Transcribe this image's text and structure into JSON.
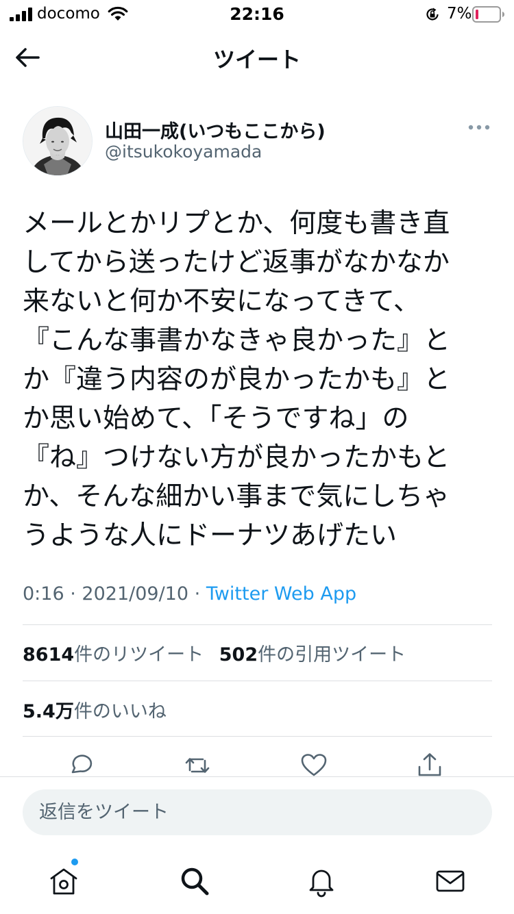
{
  "status_bar": {
    "carrier": "docomo",
    "time": "22:16",
    "battery": "7%",
    "icons": [
      "signal-icon",
      "wifi-icon",
      "orientation-lock-icon",
      "battery-icon"
    ]
  },
  "header": {
    "title": "ツイート",
    "back_icon": "back-arrow-icon"
  },
  "tweet": {
    "author": {
      "name": "山田一成(いつもここから)",
      "handle": "@itsukokoyamada"
    },
    "body_lines": [
      "メールとかリプとか、何度も書き直",
      "してから送ったけど返事がなかなか",
      "来ないと何か不安になってきて、",
      "『こんな事書かなきゃ良かった』と",
      "か『違う内容のが良かったかも』と",
      "か思い始めて、「そうですね」の",
      "『ね』つけない方が良かったかもと",
      "か、そんな細かい事まで気にしちゃ",
      "うような人にドーナツあげたい"
    ],
    "time": "0:16",
    "date": "2021/09/10",
    "separator": "·",
    "source": "Twitter Web App",
    "stats": {
      "retweets_count": "8614",
      "retweets_label": "件のリツイート",
      "quotes_count": "502",
      "quotes_label": "件の引用ツイート",
      "likes_count": "5.4万",
      "likes_label": "件のいいね"
    },
    "actions": [
      "reply-icon",
      "retweet-icon",
      "like-icon",
      "share-icon"
    ]
  },
  "reply_box": {
    "placeholder": "返信をツイート",
    "value": ""
  },
  "bottom_nav": [
    "home-icon",
    "search-icon",
    "notifications-icon",
    "messages-icon"
  ],
  "colors": {
    "accent": "#1d9bf0",
    "text": "#0f1419",
    "secondary_text": "#536471",
    "divider": "#dcdfe2",
    "input_bg": "#eff3f4",
    "battery_low": "#e0245e"
  }
}
